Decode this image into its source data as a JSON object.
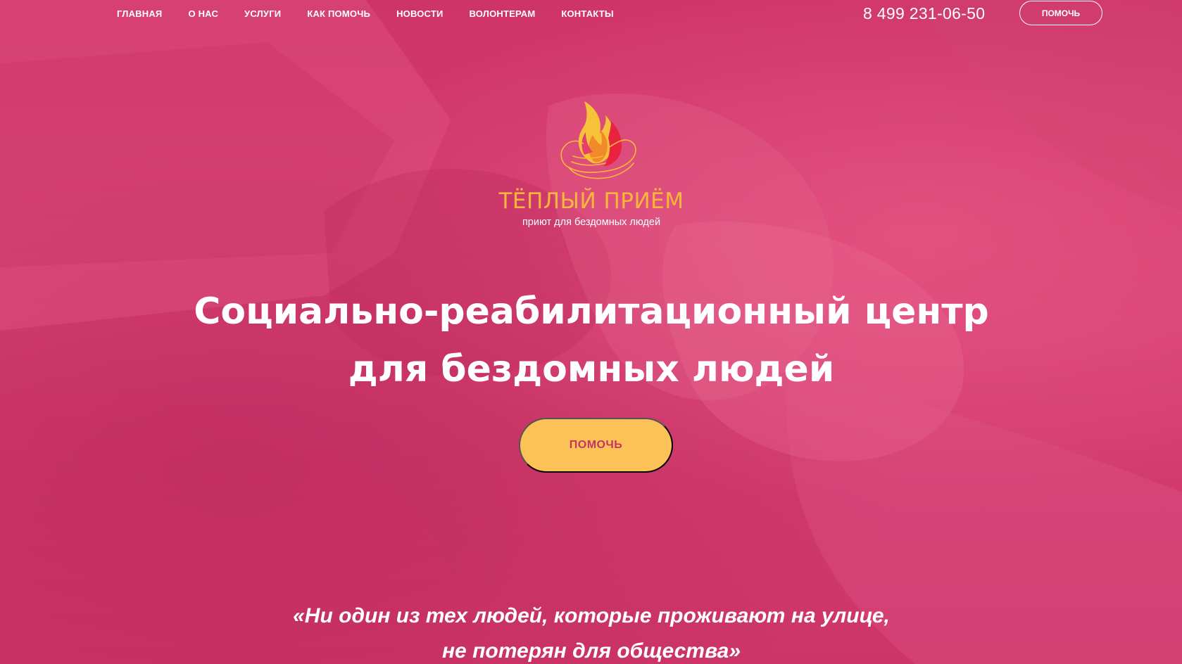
{
  "nav": {
    "links": [
      "ГЛАВНАЯ",
      "О НАС",
      "УСЛУГИ",
      "КАК ПОМОЧЬ",
      "НОВОСТИ",
      "ВОЛОНТЕРАМ",
      "КОНТАКТЫ"
    ],
    "phone": "8 499 231-06-50",
    "help_label": "ПОМОЧЬ"
  },
  "logo": {
    "title": "ТЁПЛЫЙ ПРИЁМ",
    "subtitle": "приют для бездомных людей",
    "icon": "flame-in-hands-icon"
  },
  "hero": {
    "heading_line1": "Социально-реабилитационный центр",
    "heading_line2": "для бездомных людей",
    "cta_label": "ПОМОЧЬ",
    "quote_line1": "«Ни один из тех людей, которые проживают на улице,",
    "quote_line2": "не потерян для общества»"
  },
  "colors": {
    "background": "#d23a6e",
    "accent_yellow": "#fcc157",
    "logo_orange": "#fcb73a",
    "cta_text": "#c23660",
    "text": "#ffffff"
  }
}
